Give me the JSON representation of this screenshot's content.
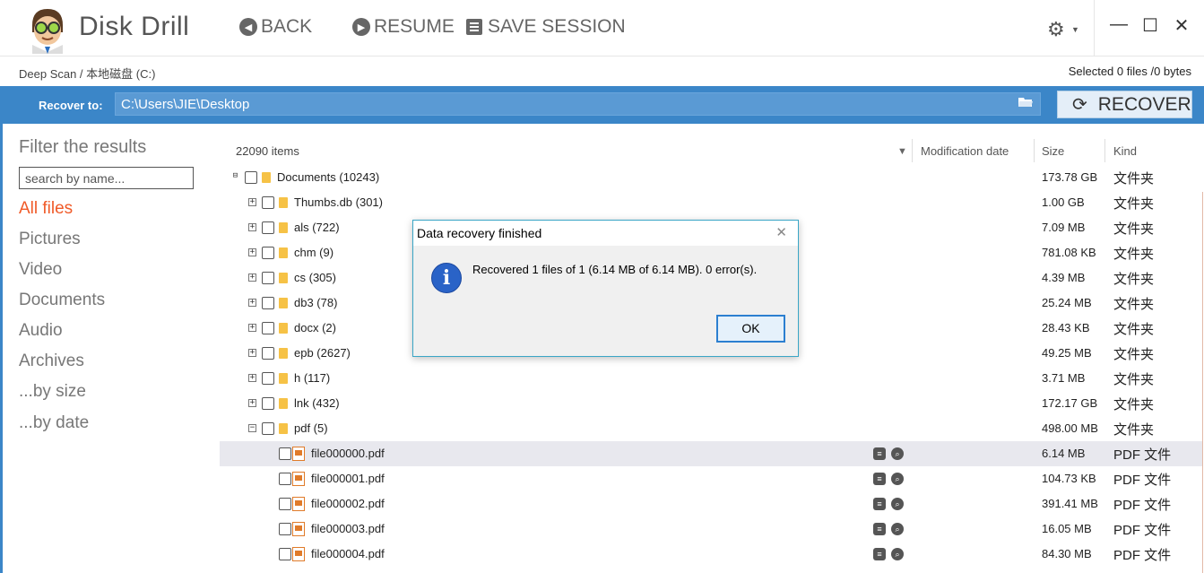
{
  "app": {
    "title": "Disk Drill",
    "colors": {
      "accent": "#3b86c8",
      "active_category": "#f05a28"
    }
  },
  "toolbar": {
    "back_label": "BACK",
    "resume_label": "RESUME",
    "save_session_label": "SAVE SESSION",
    "settings_icon": "gear-icon",
    "window": {
      "minimize": "—",
      "maximize": "☐",
      "close": "✕"
    }
  },
  "breadcrumb": {
    "text": "Deep Scan / 本地磁盘 (C:)"
  },
  "selection": {
    "text": "Selected 0 files /0 bytes"
  },
  "recover_bar": {
    "label": "Recover to:",
    "path": "C:\\Users\\JIE\\Desktop",
    "recover_label": "RECOVER"
  },
  "filter": {
    "title": "Filter the results",
    "search_placeholder": "search by name...",
    "categories": [
      "All files",
      "Pictures",
      "Video",
      "Documents",
      "Audio",
      "Archives",
      "...by size",
      "...by date"
    ],
    "active_index": 0
  },
  "list": {
    "count": "22090 items",
    "columns": {
      "date": "Modification date",
      "size": "Size",
      "kind": "Kind"
    },
    "rows": [
      {
        "name": "Documents (10243)",
        "size": "173.78 GB",
        "kind": "文件夹",
        "exp": "⊟"
      },
      {
        "name": "Thumbs.db (301)",
        "size": "1.00 GB",
        "kind": "文件夹",
        "exp": "+"
      },
      {
        "name": "als (722)",
        "size": "7.09 MB",
        "kind": "文件夹",
        "exp": "+"
      },
      {
        "name": "chm (9)",
        "size": "781.08 KB",
        "kind": "文件夹",
        "exp": "+"
      },
      {
        "name": "cs (305)",
        "size": "4.39 MB",
        "kind": "文件夹",
        "exp": "+"
      },
      {
        "name": "db3 (78)",
        "size": "25.24 MB",
        "kind": "文件夹",
        "exp": "+"
      },
      {
        "name": "docx (2)",
        "size": "28.43 KB",
        "kind": "文件夹",
        "exp": "+"
      },
      {
        "name": "epb (2627)",
        "size": "49.25 MB",
        "kind": "文件夹",
        "exp": "+"
      },
      {
        "name": "h (117)",
        "size": "3.71 MB",
        "kind": "文件夹",
        "exp": "+"
      },
      {
        "name": "lnk (432)",
        "size": "172.17 GB",
        "kind": "文件夹",
        "exp": "+"
      },
      {
        "name": "pdf (5)",
        "size": "498.00 MB",
        "kind": "文件夹",
        "exp": "−"
      },
      {
        "name": "file000000.pdf",
        "size": "6.14 MB",
        "kind": "PDF 文件"
      },
      {
        "name": "file000001.pdf",
        "size": "104.73 KB",
        "kind": "PDF 文件"
      },
      {
        "name": "file000002.pdf",
        "size": "391.41 MB",
        "kind": "PDF 文件"
      },
      {
        "name": "file000003.pdf",
        "size": "16.05 MB",
        "kind": "PDF 文件"
      },
      {
        "name": "file000004.pdf",
        "size": "84.30 MB",
        "kind": "PDF 文件"
      }
    ]
  },
  "dialog": {
    "title": "Data recovery finished",
    "message": "Recovered 1 files of 1 (6.14 MB of 6.14 MB). 0 error(s).",
    "ok_label": "OK",
    "close_glyph": "✕",
    "icon_glyph": "i"
  }
}
